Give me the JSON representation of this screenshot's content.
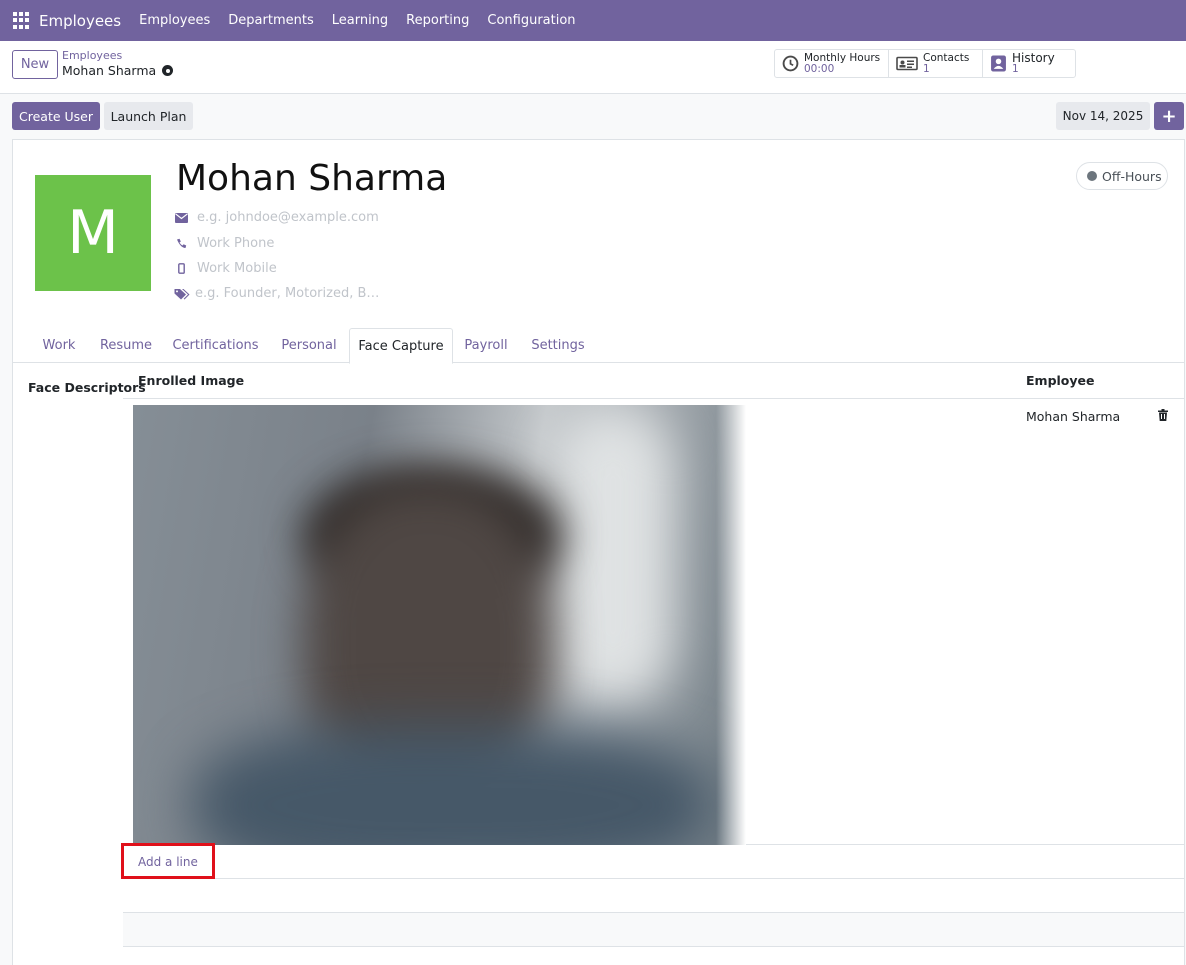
{
  "navbar": {
    "app_name": "Employees",
    "menu": [
      "Employees",
      "Departments",
      "Learning",
      "Reporting",
      "Configuration"
    ]
  },
  "control_panel": {
    "new_button": "New",
    "breadcrumb_parent": "Employees",
    "breadcrumb_current": "Mohan Sharma",
    "stats": {
      "monthly_hours_label": "Monthly Hours",
      "monthly_hours_value": "00:00",
      "contacts_label": "Contacts",
      "contacts_value": "1",
      "history_label": "History",
      "history_value": "1"
    }
  },
  "actions": {
    "create_user": "Create User",
    "launch_plan": "Launch Plan",
    "date": "Nov 14, 2025",
    "plus": "+"
  },
  "employee": {
    "avatar_letter": "M",
    "avatar_color": "#6cc24a",
    "name": "Mohan Sharma",
    "email_placeholder": "e.g. johndoe@example.com",
    "work_phone_placeholder": "Work Phone",
    "work_mobile_placeholder": "Work Mobile",
    "tags_placeholder": "e.g. Founder, Motorized, B…",
    "presence": "Off-Hours"
  },
  "tabs": [
    "Work",
    "Resume",
    "Certifications",
    "Personal",
    "Face Capture",
    "Payroll",
    "Settings"
  ],
  "active_tab": "Face Capture",
  "face_capture": {
    "section_label": "Face Descriptors",
    "columns": {
      "image": "Enrolled Image",
      "employee": "Employee"
    },
    "rows": [
      {
        "employee": "Mohan Sharma"
      }
    ],
    "add_line": "Add a line"
  },
  "colors": {
    "brand": "#71639e",
    "highlight": "#e0101a"
  }
}
